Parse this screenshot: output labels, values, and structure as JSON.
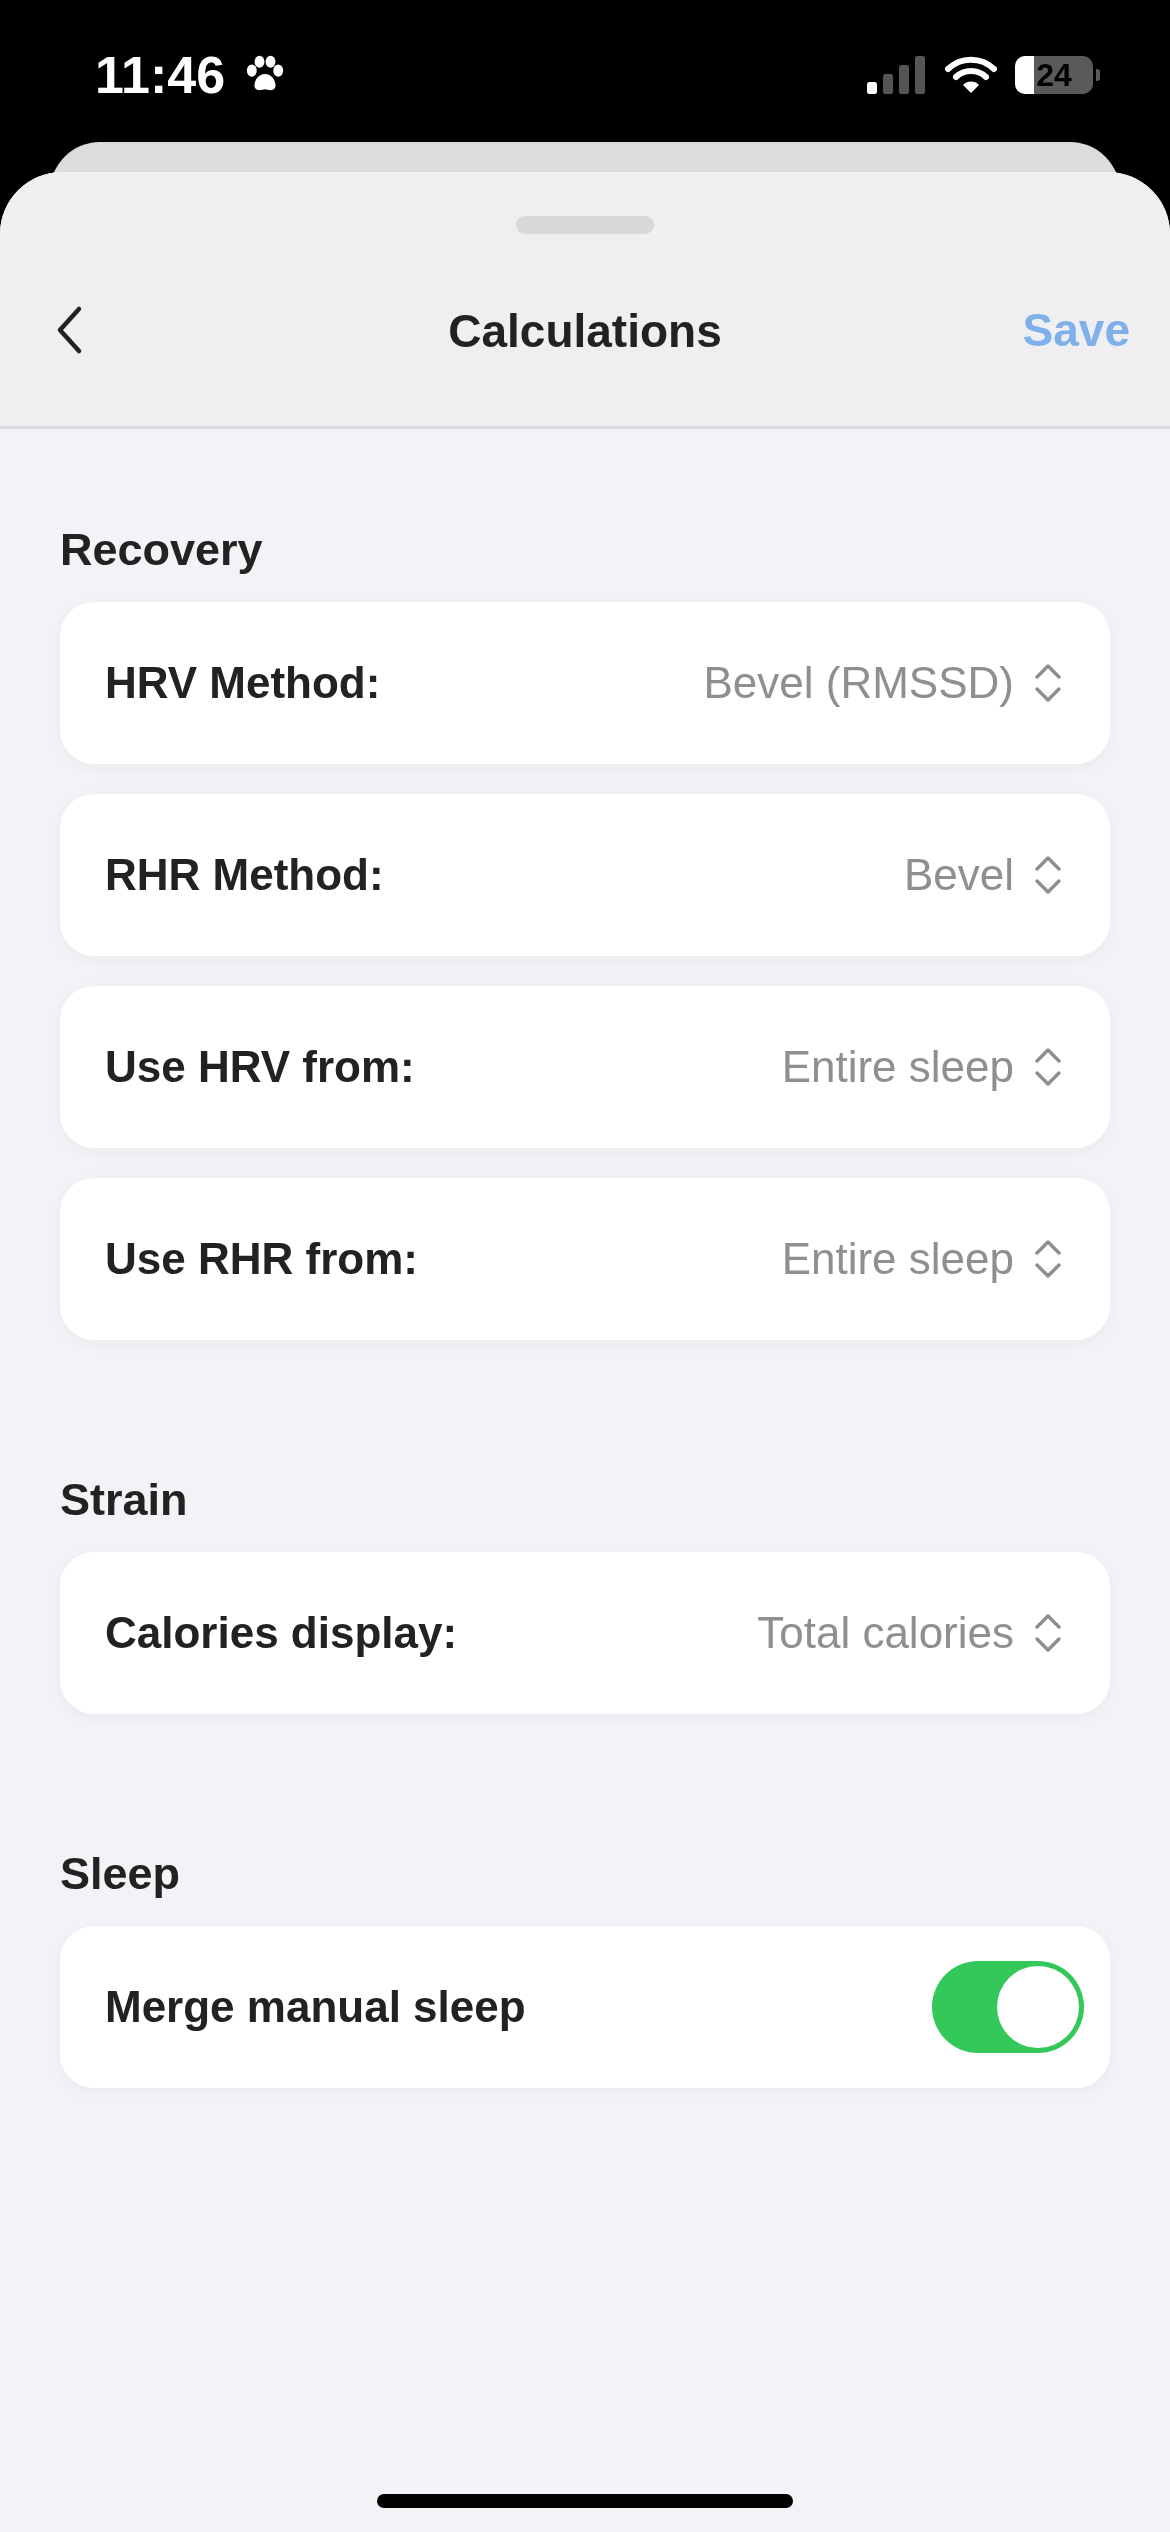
{
  "status_bar": {
    "time": "11:46",
    "battery": "24"
  },
  "header": {
    "title": "Calculations",
    "save": {
      "label": "Save",
      "disabled": true
    }
  },
  "sections": [
    {
      "title": "Recovery",
      "rows": [
        {
          "kind": "picker",
          "label": "HRV Method:",
          "value": "Bevel (RMSSD)"
        },
        {
          "kind": "picker",
          "label": "RHR Method:",
          "value": "Bevel"
        },
        {
          "kind": "picker",
          "label": "Use HRV from:",
          "value": "Entire sleep"
        },
        {
          "kind": "picker",
          "label": "Use RHR from:",
          "value": "Entire sleep"
        }
      ]
    },
    {
      "title": "Strain",
      "rows": [
        {
          "kind": "picker",
          "label": "Calories display:",
          "value": "Total calories"
        }
      ]
    },
    {
      "title": "Sleep",
      "rows": [
        {
          "kind": "toggle",
          "label": "Merge manual sleep",
          "on": true
        }
      ]
    }
  ]
}
